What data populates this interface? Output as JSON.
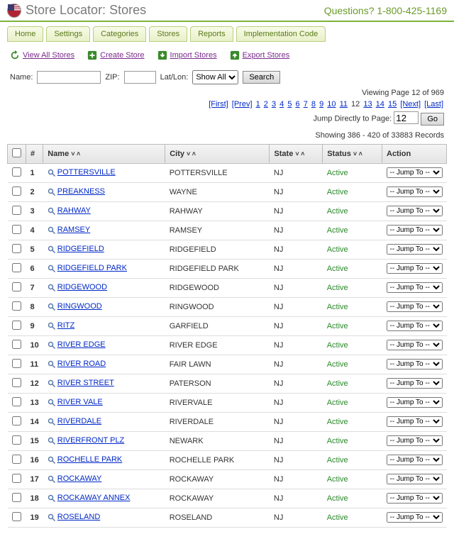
{
  "header": {
    "title": "Store Locator: Stores",
    "phone": "Questions? 1-800-425-1169"
  },
  "tabs": [
    "Home",
    "Settings",
    "Categories",
    "Stores",
    "Reports",
    "Implementation Code"
  ],
  "actions": {
    "view_all": "View All Stores",
    "create": "Create Store",
    "import": "Import Stores",
    "export": "Export Stores"
  },
  "search": {
    "name_label": "Name:",
    "zip_label": "ZIP:",
    "latlon_label": "Lat/Lon:",
    "latlon_value": "Show All",
    "search_btn": "Search"
  },
  "paging": {
    "viewing": "Viewing Page 12 of 969",
    "first": "[First]",
    "prev": "[Prev]",
    "pages": [
      "1",
      "2",
      "3",
      "4",
      "5",
      "6",
      "7",
      "8",
      "9",
      "10",
      "11",
      "12",
      "13",
      "14",
      "15"
    ],
    "current_page": "12",
    "next": "[Next]",
    "last": "[Last]",
    "jump_label": "Jump Directly to Page:",
    "jump_value": "12",
    "go": "Go",
    "showing": "Showing 386 - 420 of 33883 Records"
  },
  "table": {
    "headers": {
      "num": "#",
      "name": "Name",
      "city": "City",
      "state": "State",
      "status": "Status",
      "action": "Action",
      "sort": "˅ ˄"
    },
    "action_option": "-- Jump To --",
    "rows": [
      {
        "n": "1",
        "name": "POTTERSVILLE",
        "city": "POTTERSVILLE",
        "state": "NJ",
        "status": "Active"
      },
      {
        "n": "2",
        "name": "PREAKNESS",
        "city": "WAYNE",
        "state": "NJ",
        "status": "Active"
      },
      {
        "n": "3",
        "name": "RAHWAY",
        "city": "RAHWAY",
        "state": "NJ",
        "status": "Active"
      },
      {
        "n": "4",
        "name": "RAMSEY",
        "city": "RAMSEY",
        "state": "NJ",
        "status": "Active"
      },
      {
        "n": "5",
        "name": "RIDGEFIELD",
        "city": "RIDGEFIELD",
        "state": "NJ",
        "status": "Active"
      },
      {
        "n": "6",
        "name": "RIDGEFIELD PARK",
        "city": "RIDGEFIELD PARK",
        "state": "NJ",
        "status": "Active"
      },
      {
        "n": "7",
        "name": "RIDGEWOOD",
        "city": "RIDGEWOOD",
        "state": "NJ",
        "status": "Active"
      },
      {
        "n": "8",
        "name": "RINGWOOD",
        "city": "RINGWOOD",
        "state": "NJ",
        "status": "Active"
      },
      {
        "n": "9",
        "name": "RITZ",
        "city": "GARFIELD",
        "state": "NJ",
        "status": "Active"
      },
      {
        "n": "10",
        "name": "RIVER EDGE",
        "city": "RIVER EDGE",
        "state": "NJ",
        "status": "Active"
      },
      {
        "n": "11",
        "name": "RIVER ROAD",
        "city": "FAIR LAWN",
        "state": "NJ",
        "status": "Active"
      },
      {
        "n": "12",
        "name": "RIVER STREET",
        "city": "PATERSON",
        "state": "NJ",
        "status": "Active"
      },
      {
        "n": "13",
        "name": "RIVER VALE",
        "city": "RIVERVALE",
        "state": "NJ",
        "status": "Active"
      },
      {
        "n": "14",
        "name": "RIVERDALE",
        "city": "RIVERDALE",
        "state": "NJ",
        "status": "Active"
      },
      {
        "n": "15",
        "name": "RIVERFRONT PLZ",
        "city": "NEWARK",
        "state": "NJ",
        "status": "Active"
      },
      {
        "n": "16",
        "name": "ROCHELLE PARK",
        "city": "ROCHELLE PARK",
        "state": "NJ",
        "status": "Active"
      },
      {
        "n": "17",
        "name": "ROCKAWAY",
        "city": "ROCKAWAY",
        "state": "NJ",
        "status": "Active"
      },
      {
        "n": "18",
        "name": "ROCKAWAY ANNEX",
        "city": "ROCKAWAY",
        "state": "NJ",
        "status": "Active"
      },
      {
        "n": "19",
        "name": "ROSELAND",
        "city": "ROSELAND",
        "state": "NJ",
        "status": "Active"
      }
    ]
  }
}
